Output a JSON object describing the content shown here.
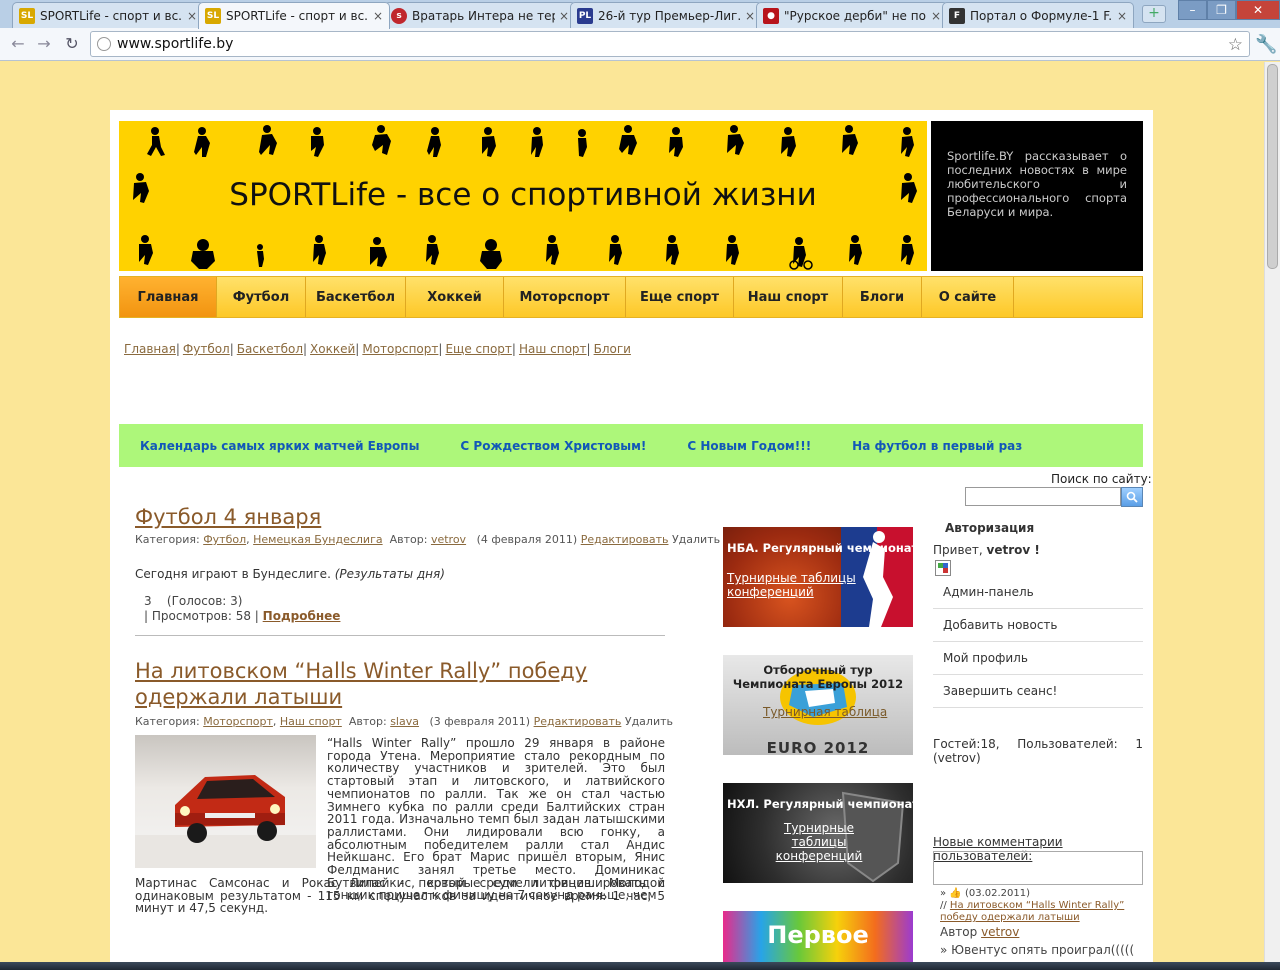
{
  "browser": {
    "tabs": [
      {
        "title": "SPORTLife - спорт и вс...",
        "fav": "SL",
        "fav_color": "#d8a800"
      },
      {
        "title": "SPORTLife - спорт и вс...",
        "fav": "SL",
        "fav_color": "#d8a800"
      },
      {
        "title": "Вратарь Интера не тер...",
        "fav": "s",
        "fav_color": "#c0272d"
      },
      {
        "title": "26-й тур Премьер-Лиг...",
        "fav": "PL",
        "fav_color": "#2a3b8f"
      },
      {
        "title": "\"Рурское дерби\" не по...",
        "fav": "●",
        "fav_color": "#b8141b"
      },
      {
        "title": "Портал о Формуле-1 F...",
        "fav": "F",
        "fav_color": "#333333"
      }
    ],
    "url": "www.sportlife.by"
  },
  "banner": {
    "title": "SPORTLife - все о спортивной жизни",
    "about": "Sportlife.BY рассказывает о последних новостях в мире любительского и профессионального спорта Беларуси и мира."
  },
  "main_nav": [
    {
      "label": "Главная",
      "width": 97
    },
    {
      "label": "Футбол",
      "width": 89
    },
    {
      "label": "Баскетбол",
      "width": 100
    },
    {
      "label": "Хоккей",
      "width": 98
    },
    {
      "label": "Моторспорт",
      "width": 122
    },
    {
      "label": "Еще спорт",
      "width": 108
    },
    {
      "label": "Наш спорт",
      "width": 109
    },
    {
      "label": "Блоги",
      "width": 79
    },
    {
      "label": "О сайте",
      "width": 92
    }
  ],
  "sub_nav": [
    "Главная",
    "Футбол",
    "Баскетбол",
    "Хоккей",
    "Моторспорт",
    "Еще спорт",
    "Наш спорт",
    "Блоги"
  ],
  "green_links": [
    "Календарь самых ярких матчей Европы",
    "С Рождеством Христовым!",
    "С Новым Годом!!!",
    "На футбол в первый раз"
  ],
  "search": {
    "label": "Поиск по сайту:"
  },
  "articles": [
    {
      "title": "Футбол 4 января",
      "category_label": "Категория:",
      "categories": [
        "Футбол",
        "Немецкая Бундеслига"
      ],
      "author_label": "Автор:",
      "author": "vetrov",
      "date": "(4 февраля 2011)",
      "edit": "Редактировать",
      "delete": "Удалить",
      "text": "Сегодня играют в Бундеслиге.",
      "text_italic": "(Результаты дня)",
      "rating": "3",
      "votes": "(Голосов: 3)",
      "views": "| Просмотров: 58 |",
      "more": "Подробнее"
    },
    {
      "title": "На литовском “Halls Winter Rally” победу одержали латыши",
      "category_label": "Категория:",
      "categories": [
        "Моторспорт",
        "Наш спорт"
      ],
      "author_label": "Автор:",
      "author": "slava",
      "date": "(3 февраля 2011)",
      "edit": "Редактировать",
      "delete": "Удалить",
      "text_right": "“Halls Winter Rally” прошло 29 января в районе города Утена. Мероприятие стало рекордным по количеству участников и зрителей. Это был стартовый этап и литовского, и латвийского чемпионатов по ралли. Так же он стал частью Зимнего кубка по ралли среди Балтийских стран 2011 года. Изначально темп был задан латышскими раллистами. Они лидировали всю гонку, а абсолютным победителем ралли стал Андис Нейкшанс. Его брат Марис пришёл вторым, Янис Фелдманис занял третье место. Доминикас Бутвилас - первый среди литовцев. Молодой гонщик пришел к финишу на 7 секунд раньше, чем",
      "text_full": "Мартинас Самсонас и Рокас Липейкис, которые сумели финишировать с одинаковым результатом - 115 км спецучастков за идентичное время: 1 час, 5 минут и 47,5 секунд."
    }
  ],
  "promos": [
    {
      "title": "НБА. Регулярный чемпионат",
      "link": "Турнирные таблицы конференций"
    },
    {
      "title": "Отборочный тур Чемпионата Европы 2012",
      "link": "Турнирная таблица",
      "logo": "EURO 2012"
    },
    {
      "title": "НХЛ. Регулярный чемпионат",
      "link": "Турнирные таблицы конференций"
    },
    {
      "title": "Первое"
    }
  ],
  "sidebar": {
    "auth_title": "Авторизация",
    "hello": "Привет,",
    "user": "vetrov !",
    "menu": [
      "Админ-панель",
      "Добавить новость",
      "Мой профиль",
      "Завершить сеанс!"
    ],
    "online": "Гостей:18, Пользователей: 1 (vetrov)",
    "new_comments": "Новые комментарии пользователей:",
    "comment_date": "(03.02.2011)",
    "comment_link": "На литовском “Halls Winter Rally” победу одержали латыши",
    "comment_author_label": "Автор",
    "comment_author": "vetrov",
    "next_comment": "» Ювентус опять проиграл((((("
  },
  "colors": {
    "accent": "#ffd200",
    "nav_active": "#f29410",
    "green": "#adf77a",
    "link": "#8a5a2a"
  }
}
